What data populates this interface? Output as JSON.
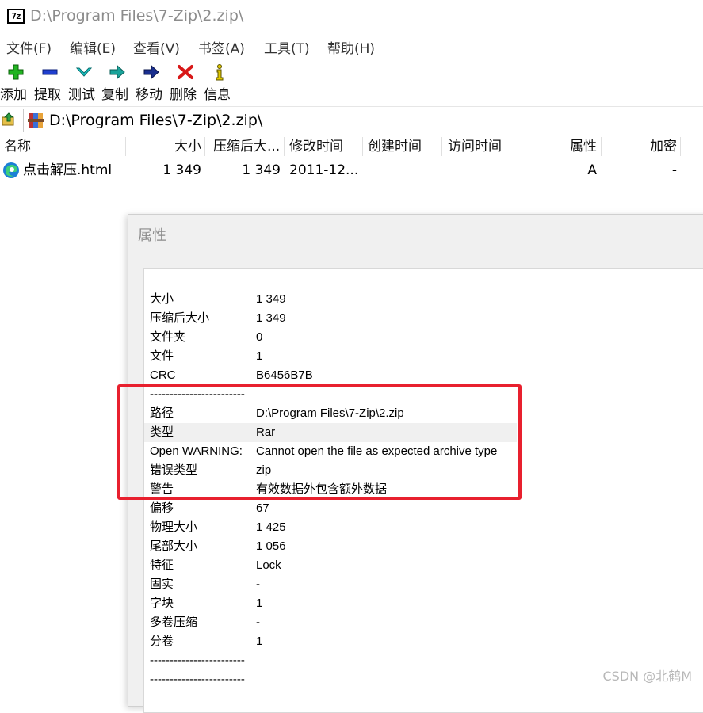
{
  "window": {
    "title": "D:\\Program Files\\7-Zip\\2.zip\\",
    "app_icon_text": "7z"
  },
  "menu": [
    "文件(F)",
    "编辑(E)",
    "查看(V)",
    "书签(A)",
    "工具(T)",
    "帮助(H)"
  ],
  "toolbar": [
    {
      "label": "添加",
      "icon": "add-icon"
    },
    {
      "label": "提取",
      "icon": "extract-icon"
    },
    {
      "label": "测试",
      "icon": "test-icon"
    },
    {
      "label": "复制",
      "icon": "copy-icon"
    },
    {
      "label": "移动",
      "icon": "move-icon"
    },
    {
      "label": "删除",
      "icon": "delete-icon"
    },
    {
      "label": "信息",
      "icon": "info-icon"
    }
  ],
  "address": {
    "path": "D:\\Program Files\\7-Zip\\2.zip\\"
  },
  "columns": [
    "名称",
    "大小",
    "压缩后大...",
    "修改时间",
    "创建时间",
    "访问时间",
    "属性",
    "加密"
  ],
  "files": [
    {
      "name": "点击解压.html",
      "size": "1 349",
      "packed": "1 349",
      "modified": "2011-12...",
      "created": "",
      "accessed": "",
      "attributes": "A",
      "encrypted": "-"
    }
  ],
  "dialog": {
    "title": "属性",
    "properties": [
      {
        "key": "大小",
        "value": "1 349"
      },
      {
        "key": "压缩后大小",
        "value": "1 349"
      },
      {
        "key": "文件夹",
        "value": "0"
      },
      {
        "key": "文件",
        "value": "1"
      },
      {
        "key": "CRC",
        "value": "B6456B7B"
      },
      {
        "key": "------------------------",
        "value": ""
      },
      {
        "key": "路径",
        "value": "D:\\Program Files\\7-Zip\\2.zip"
      },
      {
        "key": "类型",
        "value": "Rar"
      },
      {
        "key": "Open WARNING:",
        "value": "Cannot open the file as expected archive type"
      },
      {
        "key": "错误类型",
        "value": "zip"
      },
      {
        "key": "警告",
        "value": "有效数据外包含额外数据"
      },
      {
        "key": "偏移",
        "value": "67"
      },
      {
        "key": "物理大小",
        "value": "1 425"
      },
      {
        "key": "尾部大小",
        "value": "1 056"
      },
      {
        "key": "特征",
        "value": "Lock"
      },
      {
        "key": "固实",
        "value": "-"
      },
      {
        "key": "字块",
        "value": "1"
      },
      {
        "key": "多卷压缩",
        "value": "-"
      },
      {
        "key": "分卷",
        "value": "1"
      },
      {
        "key": "------------------------",
        "value": ""
      },
      {
        "key": "------------------------",
        "value": ""
      }
    ]
  },
  "watermark": "CSDN @北鹤M",
  "colors": {
    "highlight_box": "#e8202e",
    "selected_row": "#f0f0f0"
  }
}
